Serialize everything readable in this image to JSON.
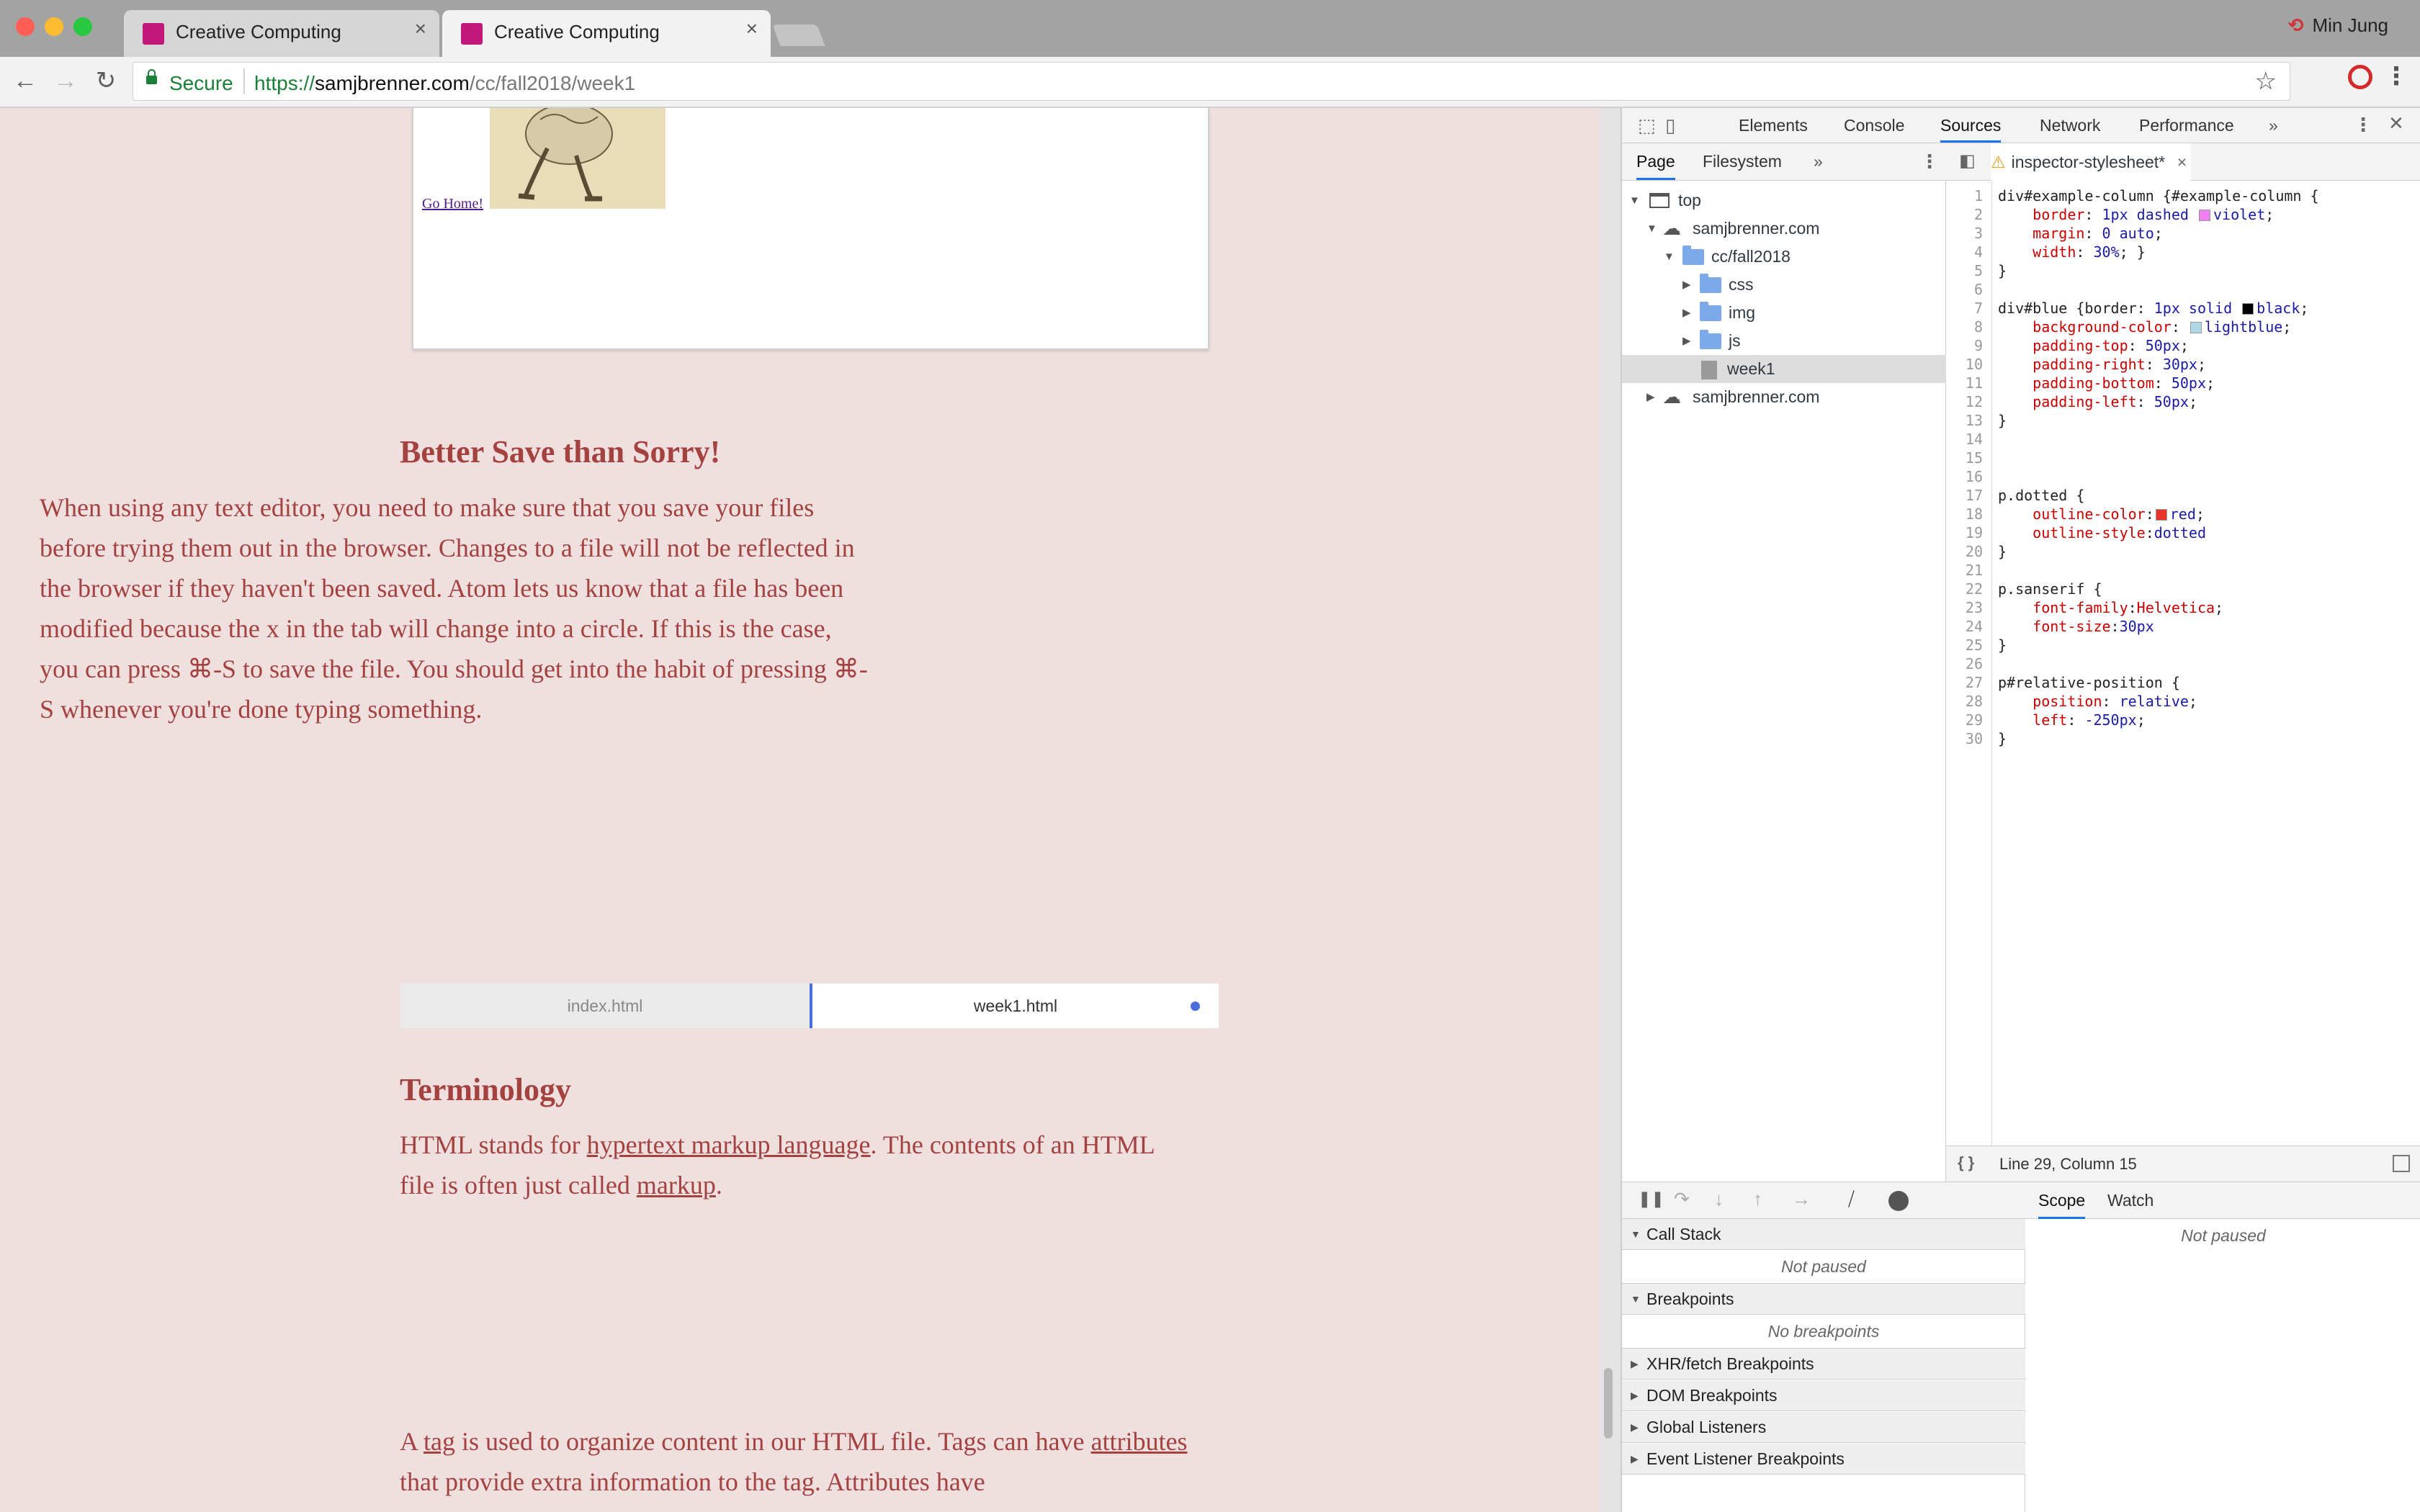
{
  "browser": {
    "tabs": [
      {
        "title": "Creative Computing",
        "close": "×"
      },
      {
        "title": "Creative Computing",
        "close": "×"
      }
    ],
    "profile_name": "Min Jung",
    "profile_icon": "⟲",
    "back_glyph": "←",
    "forward_glyph": "→",
    "reload_glyph": "↻",
    "secure_label": "Secure",
    "url": {
      "scheme": "https://",
      "host": "samjbrenner.com",
      "path": "/cc/fall2018/week1"
    },
    "star_glyph": "☆",
    "menu_glyph": "⋮"
  },
  "page": {
    "go_home_link": "Go Home!",
    "save_heading": "Better Save than Sorry!",
    "save_paragraph": "When using any text editor, you need to make sure that you save your files before trying them out in the browser. Changes to a file will not be reflected in the browser if they haven't been saved. Atom lets us know that a file has been modified because the x in the tab will change into a circle. If this is the case, you can press ⌘-S to save the file. You should get into the habit of pressing ⌘-S whenever you're done typing something.",
    "atom_tabs": [
      "index.html",
      "week1.html"
    ],
    "term_heading": "Terminology",
    "term_p1": {
      "t1": "HTML stands for ",
      "link1": "hypertext markup language",
      "t2": ". The contents of an HTML file is often just called ",
      "link2": "markup",
      "t3": "."
    },
    "term_p2": {
      "t1": "A ",
      "link1": "tag",
      "t2": " is used to organize content in our HTML file. Tags can have ",
      "link2": "attributes",
      "t3": " that provide extra information to the tag. Attributes have"
    }
  },
  "devtools": {
    "panels": [
      "Elements",
      "Console",
      "Sources",
      "Network",
      "Performance"
    ],
    "more_glyph": "»",
    "nav_tabs": [
      "Page",
      "Filesystem"
    ],
    "file_tab": "inspector-stylesheet*",
    "file_close": "×",
    "tree": [
      {
        "label": "top",
        "level": 0,
        "kind": "frame",
        "open": true
      },
      {
        "label": "samjbrenner.com",
        "level": 1,
        "kind": "cloud",
        "open": true
      },
      {
        "label": "cc/fall2018",
        "level": 2,
        "kind": "folder",
        "open": true
      },
      {
        "label": "css",
        "level": 3,
        "kind": "folder",
        "open": false
      },
      {
        "label": "img",
        "level": 3,
        "kind": "folder",
        "open": false
      },
      {
        "label": "js",
        "level": 3,
        "kind": "folder",
        "open": false
      },
      {
        "label": "week1",
        "level": 3,
        "kind": "file",
        "open": null
      },
      {
        "label": "samjbrenner.com",
        "level": 1,
        "kind": "cloud",
        "open": false
      }
    ],
    "line_numbers": [
      "1",
      "2",
      "3",
      "4",
      "5",
      "6",
      "7",
      "8",
      "9",
      "10",
      "11",
      "12",
      "13",
      "14",
      "15",
      "16",
      "17",
      "18",
      "19",
      "20",
      "21",
      "22",
      "23",
      "24",
      "25",
      "26",
      "27",
      "28",
      "29",
      "30"
    ],
    "code": {
      "l1": "div#example-column {#example-column {",
      "l2p": "border",
      "l2a": "1px dashed",
      "l2b": "violet",
      "l3p": "margin",
      "l3a": "0 auto",
      "l4p": "width",
      "l4a": "30%",
      "l7": "div#blue {border: ",
      "l7a": "1px solid",
      "l7b": "black",
      "l8p": "background-color",
      "l8b": "lightblue",
      "l9p": "padding-top",
      "l9a": "50px",
      "l10p": "padding-right",
      "l10a": "30px",
      "l11p": "padding-bottom",
      "l11a": "50px",
      "l12p": "padding-left",
      "l12a": "50px",
      "l17": "p.dotted {",
      "l18p": "outline-color",
      "l18b": "red",
      "l19p": "outline-style",
      "l19a": "dotted",
      "l22": "p.sanserif {",
      "l23p": "font-family",
      "l23a": "Helvetica",
      "l24p": "font-size",
      "l24a": "30px",
      "l27": "p#relative-position {",
      "l28p": "position",
      "l28a": "relative",
      "l29p": "left",
      "l29a": "-250px"
    },
    "swatch_colors": {
      "violet": "#ee82ee",
      "black": "#000000",
      "lightblue": "#add8e6",
      "red": "#ff0000"
    },
    "pretty_print": "{ }",
    "cursor_status": "Line 29, Column 15",
    "debugger": {
      "sections": [
        "Call Stack",
        "Breakpoints",
        "XHR/fetch Breakpoints",
        "DOM Breakpoints",
        "Global Listeners",
        "Event Listener Breakpoints"
      ],
      "call_stack_empty": "Not paused",
      "breakpoints_empty": "No breakpoints",
      "scope_tabs": [
        "Scope",
        "Watch"
      ],
      "scope_empty": "Not paused"
    }
  },
  "colors": {
    "page_bg": "#efdfdf",
    "page_text": "#a3423f",
    "favicon": "#c2187a",
    "accent": "#1a73e8"
  }
}
